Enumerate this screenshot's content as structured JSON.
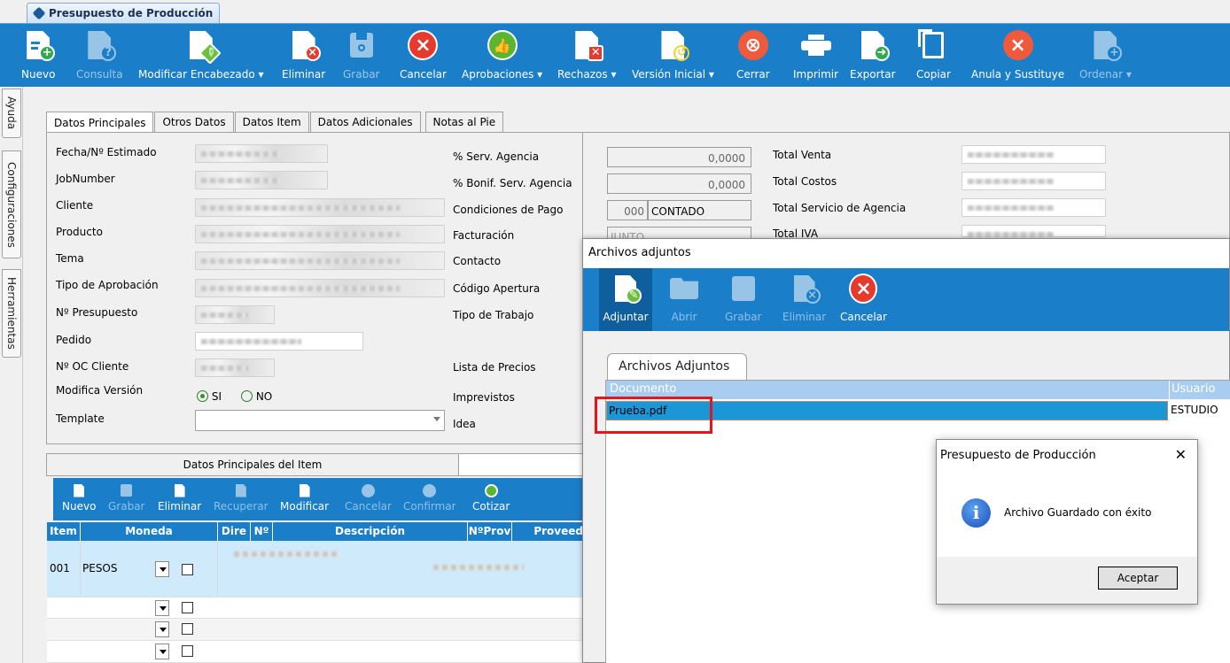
{
  "window": {
    "tab_title": "Presupuesto de Producción"
  },
  "toolbar": {
    "nuevo": "Nuevo",
    "consulta": "Consulta",
    "modificar_encabezado": "Modificar Encabezado ▾",
    "eliminar": "Eliminar",
    "grabar": "Grabar",
    "cancelar": "Cancelar",
    "aprobaciones": "Aprobaciones ▾",
    "rechazos": "Rechazos ▾",
    "version_inicial": "Versión Inicial ▾",
    "cerrar": "Cerrar",
    "imprimir": "Imprimir",
    "exportar": "Exportar",
    "copiar": "Copiar",
    "anula": "Anula y Sustituye",
    "ordenar": "Ordenar ▾"
  },
  "sidebar": {
    "items": [
      "Ayuda",
      "Configuraciones",
      "Herramientas"
    ]
  },
  "tabs": [
    "Datos Principales",
    "Otros Datos",
    "Datos Item",
    "Datos Adicionales",
    "Notas al Pie"
  ],
  "form": {
    "left_labels": [
      "Fecha/Nº Estimado",
      "JobNumber",
      "Cliente",
      "Producto",
      "Tema",
      "Tipo de Aprobación",
      "Nº Presupuesto",
      "Pedido",
      "Nº OC Cliente",
      "Modifica Versión",
      "Template"
    ],
    "radio_si": "SI",
    "radio_no": "NO",
    "mid_labels": [
      "% Serv. Agencia",
      "% Bonif. Serv. Agencia",
      "Condiciones de Pago",
      "Facturación",
      "Contacto",
      "Código Apertura",
      "Tipo de Trabajo",
      "Lista de Precios",
      "Imprevistos",
      "Idea"
    ],
    "serv_agencia": "0,0000",
    "bonif_serv": "0,0000",
    "cond_pago_code": "000",
    "cond_pago_text": "CONTADO",
    "facturacion": "JUNTO",
    "right_labels": [
      "Total Venta",
      "Total Costos",
      "Total Servicio de Agencia",
      "Total IVA"
    ]
  },
  "item_section": {
    "header": "Datos Principales del Item",
    "toolbar": [
      "Nuevo",
      "Grabar",
      "Eliminar",
      "Recuperar",
      "Modificar",
      "Cancelar",
      "Confirmar",
      "Cotizar"
    ],
    "columns": [
      "Item",
      "Moneda",
      "Dire",
      "Nº",
      "Descripción",
      "NºProv",
      "Proveed"
    ],
    "row": {
      "item": "001",
      "moneda": "PESOS"
    }
  },
  "attachments": {
    "title": "Archivos adjuntos",
    "toolbar": [
      "Adjuntar",
      "Abrir",
      "Grabar",
      "Eliminar",
      "Cancelar"
    ],
    "tab": "Archivos Adjuntos",
    "columns": [
      "Documento",
      "Usuario"
    ],
    "rows": [
      {
        "documento": "Prueba.pdf",
        "usuario": "ESTUDIO"
      }
    ]
  },
  "dialog": {
    "title": "Presupuesto de Producción",
    "message": "Archivo Guardado con éxito",
    "ok": "Aceptar",
    "close": "✕"
  }
}
